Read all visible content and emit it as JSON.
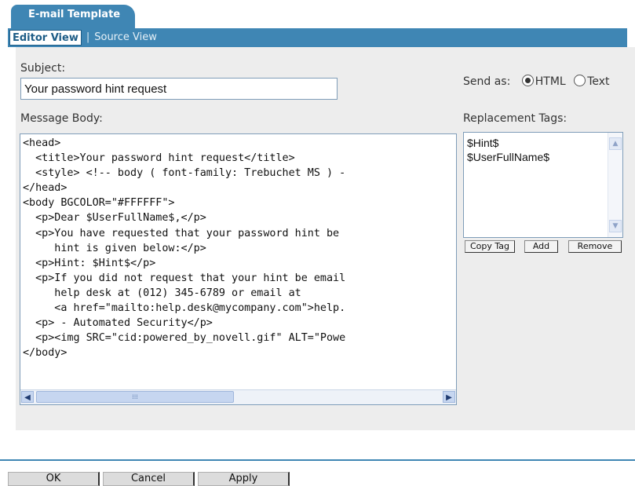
{
  "tab": {
    "title": "E-mail Template"
  },
  "views": {
    "editor": "Editor View",
    "separator": "|",
    "source": "Source View"
  },
  "subject": {
    "label": "Subject:",
    "value": "Your password hint request"
  },
  "send_as": {
    "label": "Send as:",
    "options": [
      "HTML",
      "Text"
    ],
    "selected": "HTML"
  },
  "message_body": {
    "label": "Message Body:",
    "lines": [
      "<head>",
      "  <title>Your password hint request</title>",
      "  <style> <!-- body ( font-family: Trebuchet MS ) -",
      "</head>",
      "<body BGCOLOR=\"#FFFFFF\">",
      "  <p>Dear $UserFullName$,</p>",
      "  <p>You have requested that your password hint be",
      "     hint is given below:</p>",
      "  <p>Hint: $Hint$</p>",
      "  <p>If you did not request that your hint be email",
      "     help desk at (012) 345-6789 or email at",
      "     <a href=\"mailto:help.desk@mycompany.com\">help.",
      "  <p> - Automated Security</p>",
      "  <p><img SRC=\"cid:powered_by_novell.gif\" ALT=\"Powe",
      "</body>"
    ]
  },
  "replacement_tags": {
    "label": "Replacement Tags:",
    "items": [
      "$Hint$",
      "$UserFullName$"
    ],
    "buttons": {
      "copy": "Copy Tag",
      "add": "Add",
      "remove": "Remove"
    }
  },
  "footer": {
    "ok": "OK",
    "cancel": "Cancel",
    "apply": "Apply"
  },
  "colors": {
    "accent": "#3f86b4",
    "panel": "#ededed"
  },
  "icons": {
    "scroll_left": "arrow-left-icon",
    "scroll_right": "arrow-right-icon",
    "scroll_up": "arrow-up-icon",
    "scroll_down": "arrow-down-icon"
  }
}
